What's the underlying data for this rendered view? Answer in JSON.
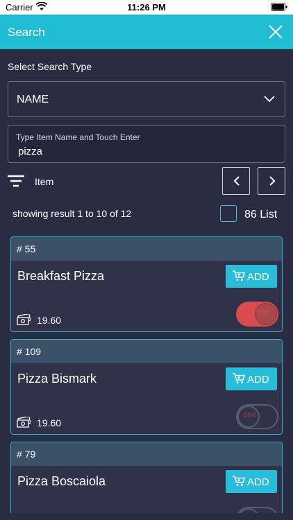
{
  "status_bar": {
    "carrier": "Carrier",
    "time": "11:26 PM"
  },
  "header": {
    "title": "Search"
  },
  "search_type": {
    "label": "Select Search Type",
    "selected": "NAME"
  },
  "search": {
    "placeholder": "Type Item Name and Touch Enter",
    "value": "pizza"
  },
  "filter": {
    "label": "Item"
  },
  "results": {
    "summary": "showing result 1 to 10 of 12",
    "list_count_label": "86 List"
  },
  "items": [
    {
      "number": "# 55",
      "name": "Breakfast Pizza",
      "add_label": "ADD",
      "price": "19.60",
      "toggle_text": "86d",
      "toggle_on": true
    },
    {
      "number": "# 109",
      "name": "Pizza Bismark",
      "add_label": "ADD",
      "price": "19.60",
      "toggle_text": "86d",
      "toggle_on": false
    },
    {
      "number": "# 79",
      "name": "Pizza Boscaiola",
      "add_label": "ADD",
      "price": "",
      "toggle_text": "",
      "toggle_on": false
    }
  ],
  "colors": {
    "accent": "#20bcd3",
    "background": "#2a2d42",
    "toggle_on": "#d94b4f"
  }
}
